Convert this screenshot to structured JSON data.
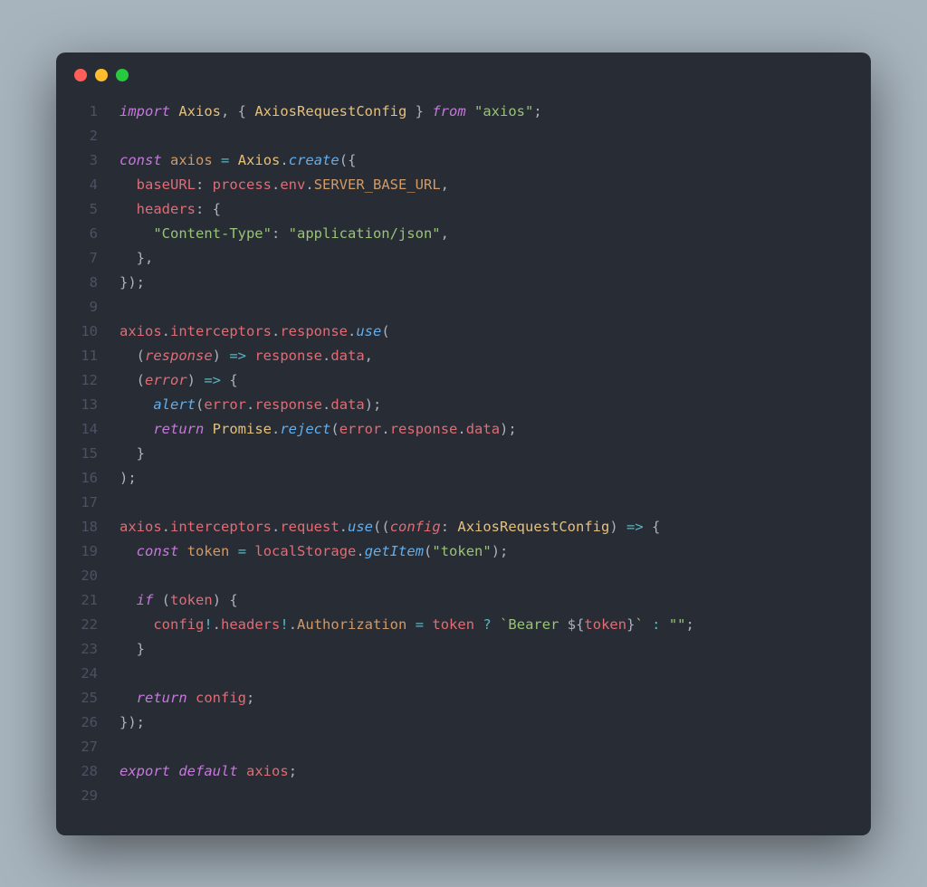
{
  "traffic": {
    "red": "#ff5f56",
    "yellow": "#ffbd2e",
    "green": "#27c93f"
  },
  "lines": [
    {
      "n": "1",
      "tokens": [
        {
          "c": "kw",
          "t": "import"
        },
        {
          "c": "punc",
          "t": " "
        },
        {
          "c": "cls",
          "t": "Axios"
        },
        {
          "c": "punc",
          "t": ", { "
        },
        {
          "c": "cls",
          "t": "AxiosRequestConfig"
        },
        {
          "c": "punc",
          "t": " } "
        },
        {
          "c": "kw",
          "t": "from"
        },
        {
          "c": "punc",
          "t": " "
        },
        {
          "c": "str",
          "t": "\"axios\""
        },
        {
          "c": "punc",
          "t": ";"
        }
      ]
    },
    {
      "n": "2",
      "tokens": []
    },
    {
      "n": "3",
      "tokens": [
        {
          "c": "kw",
          "t": "const"
        },
        {
          "c": "punc",
          "t": " "
        },
        {
          "c": "cnst",
          "t": "axios"
        },
        {
          "c": "punc",
          "t": " "
        },
        {
          "c": "op",
          "t": "="
        },
        {
          "c": "punc",
          "t": " "
        },
        {
          "c": "cls",
          "t": "Axios"
        },
        {
          "c": "punc",
          "t": "."
        },
        {
          "c": "fnit",
          "t": "create"
        },
        {
          "c": "punc",
          "t": "({"
        }
      ]
    },
    {
      "n": "4",
      "tokens": [
        {
          "c": "punc",
          "t": "  "
        },
        {
          "c": "prop",
          "t": "baseURL"
        },
        {
          "c": "punc",
          "t": ": "
        },
        {
          "c": "id",
          "t": "process"
        },
        {
          "c": "punc",
          "t": "."
        },
        {
          "c": "id",
          "t": "env"
        },
        {
          "c": "punc",
          "t": "."
        },
        {
          "c": "cnst",
          "t": "SERVER_BASE_URL"
        },
        {
          "c": "punc",
          "t": ","
        }
      ]
    },
    {
      "n": "5",
      "tokens": [
        {
          "c": "punc",
          "t": "  "
        },
        {
          "c": "prop",
          "t": "headers"
        },
        {
          "c": "punc",
          "t": ": {"
        }
      ]
    },
    {
      "n": "6",
      "tokens": [
        {
          "c": "punc",
          "t": "    "
        },
        {
          "c": "str",
          "t": "\"Content-Type\""
        },
        {
          "c": "punc",
          "t": ": "
        },
        {
          "c": "str",
          "t": "\"application/json\""
        },
        {
          "c": "punc",
          "t": ","
        }
      ]
    },
    {
      "n": "7",
      "tokens": [
        {
          "c": "punc",
          "t": "  },"
        }
      ]
    },
    {
      "n": "8",
      "tokens": [
        {
          "c": "punc",
          "t": "});"
        }
      ]
    },
    {
      "n": "9",
      "tokens": []
    },
    {
      "n": "10",
      "tokens": [
        {
          "c": "id",
          "t": "axios"
        },
        {
          "c": "punc",
          "t": "."
        },
        {
          "c": "id",
          "t": "interceptors"
        },
        {
          "c": "punc",
          "t": "."
        },
        {
          "c": "id",
          "t": "response"
        },
        {
          "c": "punc",
          "t": "."
        },
        {
          "c": "fnit",
          "t": "use"
        },
        {
          "c": "punc",
          "t": "("
        }
      ]
    },
    {
      "n": "11",
      "tokens": [
        {
          "c": "punc",
          "t": "  ("
        },
        {
          "c": "param",
          "t": "response"
        },
        {
          "c": "punc",
          "t": ") "
        },
        {
          "c": "op",
          "t": "=>"
        },
        {
          "c": "punc",
          "t": " "
        },
        {
          "c": "id",
          "t": "response"
        },
        {
          "c": "punc",
          "t": "."
        },
        {
          "c": "id",
          "t": "data"
        },
        {
          "c": "punc",
          "t": ","
        }
      ]
    },
    {
      "n": "12",
      "tokens": [
        {
          "c": "punc",
          "t": "  ("
        },
        {
          "c": "param",
          "t": "error"
        },
        {
          "c": "punc",
          "t": ") "
        },
        {
          "c": "op",
          "t": "=>"
        },
        {
          "c": "punc",
          "t": " {"
        }
      ]
    },
    {
      "n": "13",
      "tokens": [
        {
          "c": "punc",
          "t": "    "
        },
        {
          "c": "fnit",
          "t": "alert"
        },
        {
          "c": "punc",
          "t": "("
        },
        {
          "c": "id",
          "t": "error"
        },
        {
          "c": "punc",
          "t": "."
        },
        {
          "c": "id",
          "t": "response"
        },
        {
          "c": "punc",
          "t": "."
        },
        {
          "c": "id",
          "t": "data"
        },
        {
          "c": "punc",
          "t": ");"
        }
      ]
    },
    {
      "n": "14",
      "tokens": [
        {
          "c": "punc",
          "t": "    "
        },
        {
          "c": "kw",
          "t": "return"
        },
        {
          "c": "punc",
          "t": " "
        },
        {
          "c": "cls",
          "t": "Promise"
        },
        {
          "c": "punc",
          "t": "."
        },
        {
          "c": "fnit",
          "t": "reject"
        },
        {
          "c": "punc",
          "t": "("
        },
        {
          "c": "id",
          "t": "error"
        },
        {
          "c": "punc",
          "t": "."
        },
        {
          "c": "id",
          "t": "response"
        },
        {
          "c": "punc",
          "t": "."
        },
        {
          "c": "id",
          "t": "data"
        },
        {
          "c": "punc",
          "t": ");"
        }
      ]
    },
    {
      "n": "15",
      "tokens": [
        {
          "c": "punc",
          "t": "  }"
        }
      ]
    },
    {
      "n": "16",
      "tokens": [
        {
          "c": "punc",
          "t": ");"
        }
      ]
    },
    {
      "n": "17",
      "tokens": []
    },
    {
      "n": "18",
      "tokens": [
        {
          "c": "id",
          "t": "axios"
        },
        {
          "c": "punc",
          "t": "."
        },
        {
          "c": "id",
          "t": "interceptors"
        },
        {
          "c": "punc",
          "t": "."
        },
        {
          "c": "id",
          "t": "request"
        },
        {
          "c": "punc",
          "t": "."
        },
        {
          "c": "fnit",
          "t": "use"
        },
        {
          "c": "punc",
          "t": "(("
        },
        {
          "c": "param",
          "t": "config"
        },
        {
          "c": "punc",
          "t": ": "
        },
        {
          "c": "cls",
          "t": "AxiosRequestConfig"
        },
        {
          "c": "punc",
          "t": ") "
        },
        {
          "c": "op",
          "t": "=>"
        },
        {
          "c": "punc",
          "t": " {"
        }
      ]
    },
    {
      "n": "19",
      "tokens": [
        {
          "c": "punc",
          "t": "  "
        },
        {
          "c": "kw",
          "t": "const"
        },
        {
          "c": "punc",
          "t": " "
        },
        {
          "c": "cnst",
          "t": "token"
        },
        {
          "c": "punc",
          "t": " "
        },
        {
          "c": "op",
          "t": "="
        },
        {
          "c": "punc",
          "t": " "
        },
        {
          "c": "id",
          "t": "localStorage"
        },
        {
          "c": "punc",
          "t": "."
        },
        {
          "c": "fnit",
          "t": "getItem"
        },
        {
          "c": "punc",
          "t": "("
        },
        {
          "c": "str",
          "t": "\"token\""
        },
        {
          "c": "punc",
          "t": ");"
        }
      ]
    },
    {
      "n": "20",
      "tokens": []
    },
    {
      "n": "21",
      "tokens": [
        {
          "c": "punc",
          "t": "  "
        },
        {
          "c": "kw",
          "t": "if"
        },
        {
          "c": "punc",
          "t": " ("
        },
        {
          "c": "id",
          "t": "token"
        },
        {
          "c": "punc",
          "t": ") {"
        }
      ]
    },
    {
      "n": "22",
      "tokens": [
        {
          "c": "punc",
          "t": "    "
        },
        {
          "c": "id",
          "t": "config"
        },
        {
          "c": "op",
          "t": "!"
        },
        {
          "c": "punc",
          "t": "."
        },
        {
          "c": "id",
          "t": "headers"
        },
        {
          "c": "op",
          "t": "!"
        },
        {
          "c": "punc",
          "t": "."
        },
        {
          "c": "cnst",
          "t": "Authorization"
        },
        {
          "c": "punc",
          "t": " "
        },
        {
          "c": "op",
          "t": "="
        },
        {
          "c": "punc",
          "t": " "
        },
        {
          "c": "id",
          "t": "token"
        },
        {
          "c": "punc",
          "t": " "
        },
        {
          "c": "op",
          "t": "?"
        },
        {
          "c": "punc",
          "t": " "
        },
        {
          "c": "tmpl",
          "t": "`Bearer "
        },
        {
          "c": "punc",
          "t": "${"
        },
        {
          "c": "tint",
          "t": "token"
        },
        {
          "c": "punc",
          "t": "}"
        },
        {
          "c": "tmpl",
          "t": "`"
        },
        {
          "c": "punc",
          "t": " "
        },
        {
          "c": "op",
          "t": ":"
        },
        {
          "c": "punc",
          "t": " "
        },
        {
          "c": "str",
          "t": "\"\""
        },
        {
          "c": "punc",
          "t": ";"
        }
      ]
    },
    {
      "n": "23",
      "tokens": [
        {
          "c": "punc",
          "t": "  }"
        }
      ]
    },
    {
      "n": "24",
      "tokens": []
    },
    {
      "n": "25",
      "tokens": [
        {
          "c": "punc",
          "t": "  "
        },
        {
          "c": "kw",
          "t": "return"
        },
        {
          "c": "punc",
          "t": " "
        },
        {
          "c": "id",
          "t": "config"
        },
        {
          "c": "punc",
          "t": ";"
        }
      ]
    },
    {
      "n": "26",
      "tokens": [
        {
          "c": "punc",
          "t": "});"
        }
      ]
    },
    {
      "n": "27",
      "tokens": []
    },
    {
      "n": "28",
      "tokens": [
        {
          "c": "kw",
          "t": "export"
        },
        {
          "c": "punc",
          "t": " "
        },
        {
          "c": "kw",
          "t": "default"
        },
        {
          "c": "punc",
          "t": " "
        },
        {
          "c": "id",
          "t": "axios"
        },
        {
          "c": "punc",
          "t": ";"
        }
      ]
    },
    {
      "n": "29",
      "tokens": []
    }
  ]
}
